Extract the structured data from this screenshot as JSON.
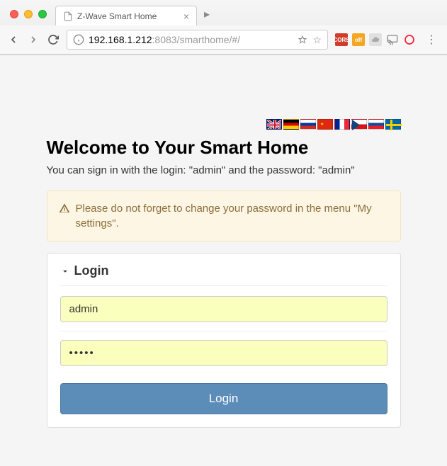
{
  "browser": {
    "tab_title": "Z-Wave Smart Home",
    "url_host": "192.168.1.212",
    "url_port_path": ":8083/smarthome/#/"
  },
  "flags": [
    {
      "name": "flag-uk",
      "label": "English"
    },
    {
      "name": "flag-de",
      "label": "Deutsch"
    },
    {
      "name": "flag-ru",
      "label": "Русский"
    },
    {
      "name": "flag-cn",
      "label": "中文"
    },
    {
      "name": "flag-fr",
      "label": "Français"
    },
    {
      "name": "flag-cz",
      "label": "Čeština"
    },
    {
      "name": "flag-sk",
      "label": "Slovenčina"
    },
    {
      "name": "flag-se",
      "label": "Svenska"
    }
  ],
  "page": {
    "heading": "Welcome to Your Smart Home",
    "subtitle": "You can sign in with the login: \"admin\" and the password: \"admin\"",
    "warning": "Please do not forget to change your password in the menu \"My settings\"."
  },
  "login": {
    "panel_title": "Login",
    "username_value": "admin",
    "password_value": "•••••",
    "button_label": "Login"
  }
}
